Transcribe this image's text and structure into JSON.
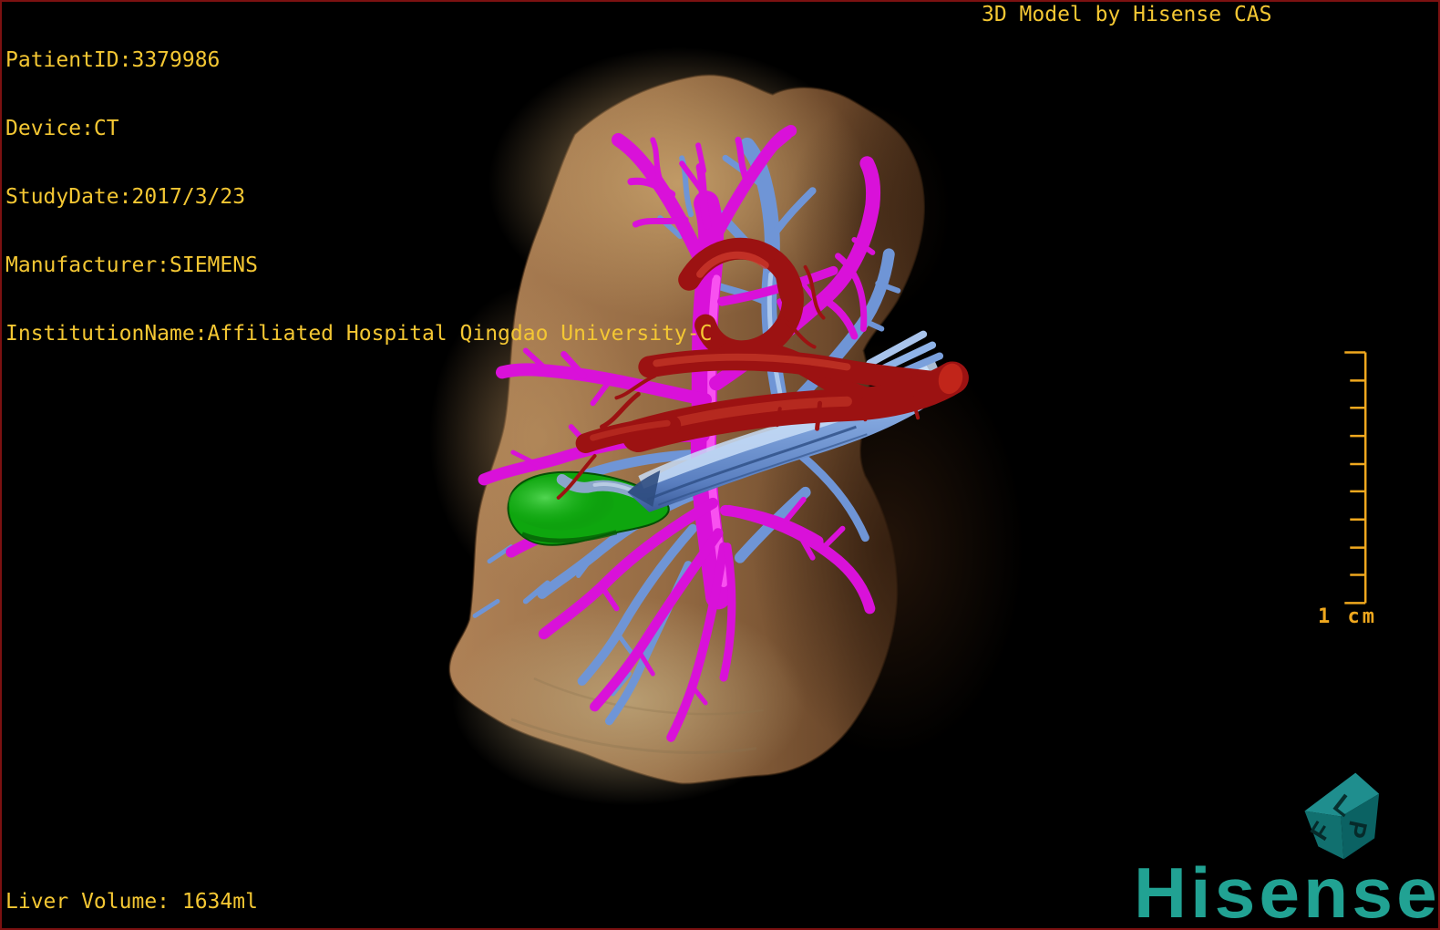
{
  "overlay": {
    "patient_info": {
      "lines": [
        "PatientID:3379986",
        "Device:CT",
        "StudyDate:2017/3/23",
        "Manufacturer:SIEMENS",
        "InstitutionName:Affiliated Hospital Qingdao University-C"
      ]
    },
    "title": "3D Model by Hisense CAS",
    "liver_volume": "Liver Volume: 1634ml",
    "scale_label": "1 cm"
  },
  "branding": {
    "logo_text": "Hisense",
    "orientation_cube": {
      "top": "L",
      "left": "F",
      "right": "P"
    }
  },
  "colors": {
    "background": "#000000",
    "border_red": "#7c1111",
    "accent_yellow": "#f4c733",
    "ruler_orange": "#f0a81e",
    "hisense_teal": "#21a293",
    "portal_vein_magenta": "#d911d9",
    "hepatic_vein_blue": "#6f95d6",
    "artery_red": "#9c1212",
    "gallbladder_green": "#0ea60e",
    "liver_brown": "#9b6f46"
  }
}
